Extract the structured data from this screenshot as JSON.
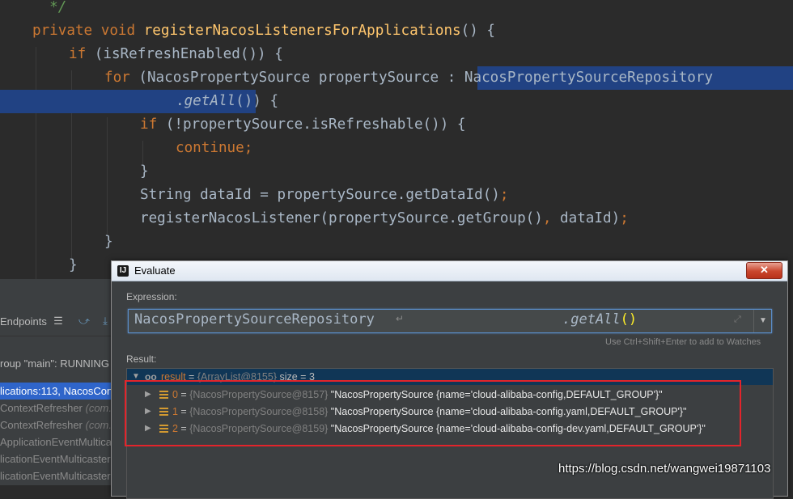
{
  "editor": {
    "lines": [
      {
        "parts": [
          {
            "t": "  */",
            "c": "cm"
          }
        ]
      },
      {
        "parts": [
          {
            "t": "private ",
            "c": "kw"
          },
          {
            "t": "void ",
            "c": "kw"
          },
          {
            "t": "registerNacosListenersForApplications",
            "c": "fn"
          },
          {
            "t": "() {",
            "c": ""
          }
        ]
      },
      {
        "parts": [
          {
            "t": "if ",
            "c": "kw"
          },
          {
            "t": "(isRefreshEnabled()) {",
            "c": ""
          }
        ]
      },
      {
        "parts": [
          {
            "t": "for ",
            "c": "kw"
          },
          {
            "t": "(NacosPropertySource propertySource : ",
            "c": ""
          },
          {
            "t": "NacosPropertySourceRepository",
            "c": ""
          }
        ]
      },
      {
        "parts": [
          {
            "t": ".",
            "c": ""
          },
          {
            "t": "getAll",
            "c": "it"
          },
          {
            "t": "()) {",
            "c": ""
          }
        ]
      },
      {
        "parts": [
          {
            "t": "if ",
            "c": "kw"
          },
          {
            "t": "(!propertySource.isRefreshable()) {",
            "c": ""
          }
        ]
      },
      {
        "parts": [
          {
            "t": "continue",
            "c": "kw"
          },
          {
            "t": ";",
            "c": "kw"
          }
        ]
      },
      {
        "parts": [
          {
            "t": "}",
            "c": ""
          }
        ]
      },
      {
        "parts": [
          {
            "t": "String dataId = propertySource.getDataId()",
            "c": ""
          },
          {
            "t": ";",
            "c": "kw"
          }
        ]
      },
      {
        "parts": [
          {
            "t": "registerNacosListener(propertySource.getGroup()",
            "c": ""
          },
          {
            "t": ", ",
            "c": "kw"
          },
          {
            "t": "dataId)",
            "c": ""
          },
          {
            "t": ";",
            "c": "kw"
          }
        ]
      },
      {
        "parts": [
          {
            "t": "}",
            "c": ""
          }
        ]
      },
      {
        "parts": [
          {
            "t": "}",
            "c": ""
          }
        ]
      },
      {
        "parts": [
          {
            "t": "}",
            "c": ""
          }
        ]
      }
    ]
  },
  "debug_panel": {
    "toolbar_label": "Endpoints",
    "icons": [
      "menu-icon",
      "step-over-icon",
      "step-into-icon"
    ],
    "thread": "roup \"main\": RUNNING",
    "frames": [
      {
        "method": "lications:113, NacosCon",
        "cls": ""
      },
      {
        "method": "ContextRefresher ",
        "cls": "(com.a"
      },
      {
        "method": "ContextRefresher ",
        "cls": "(com.a"
      },
      {
        "method": "ApplicationEventMulticas",
        "cls": ""
      },
      {
        "method": "licationEventMulticaster",
        "cls": ""
      },
      {
        "method": "licationEventMulticaster",
        "cls": ""
      }
    ]
  },
  "dialog": {
    "title": "Evaluate",
    "close_glyph": "✕",
    "expression_label": "Expression:",
    "expression_part1": "NacosPropertySourceRepository",
    "expression_part2": ".getAll",
    "expression_parens": "()",
    "newline_glyph": "↵",
    "hint": "Use Ctrl+Shift+Enter to add to Watches",
    "result_label": "Result:",
    "result": {
      "root": {
        "oo": "oo",
        "name": "result",
        "eq": " = ",
        "ref": "{ArrayList@8155}",
        "extra": "  size = 3"
      },
      "items": [
        {
          "index": "0",
          "eq": " = ",
          "ref": "{NacosPropertySource@8157}",
          "value": " \"NacosPropertySource {name='cloud-alibaba-config,DEFAULT_GROUP'}\""
        },
        {
          "index": "1",
          "eq": " = ",
          "ref": "{NacosPropertySource@8158}",
          "value": " \"NacosPropertySource {name='cloud-alibaba-config.yaml,DEFAULT_GROUP'}\""
        },
        {
          "index": "2",
          "eq": " = ",
          "ref": "{NacosPropertySource@8159}",
          "value": " \"NacosPropertySource {name='cloud-alibaba-config-dev.yaml,DEFAULT_GROUP'}\""
        }
      ]
    }
  },
  "watermark": "https://blog.csdn.net/wangwei19871103",
  "colors": {
    "editor_bg": "#2b2b2b",
    "keyword": "#cc7832",
    "method": "#ffc66d",
    "selection": "#214283",
    "highlight": "#e3242b"
  }
}
